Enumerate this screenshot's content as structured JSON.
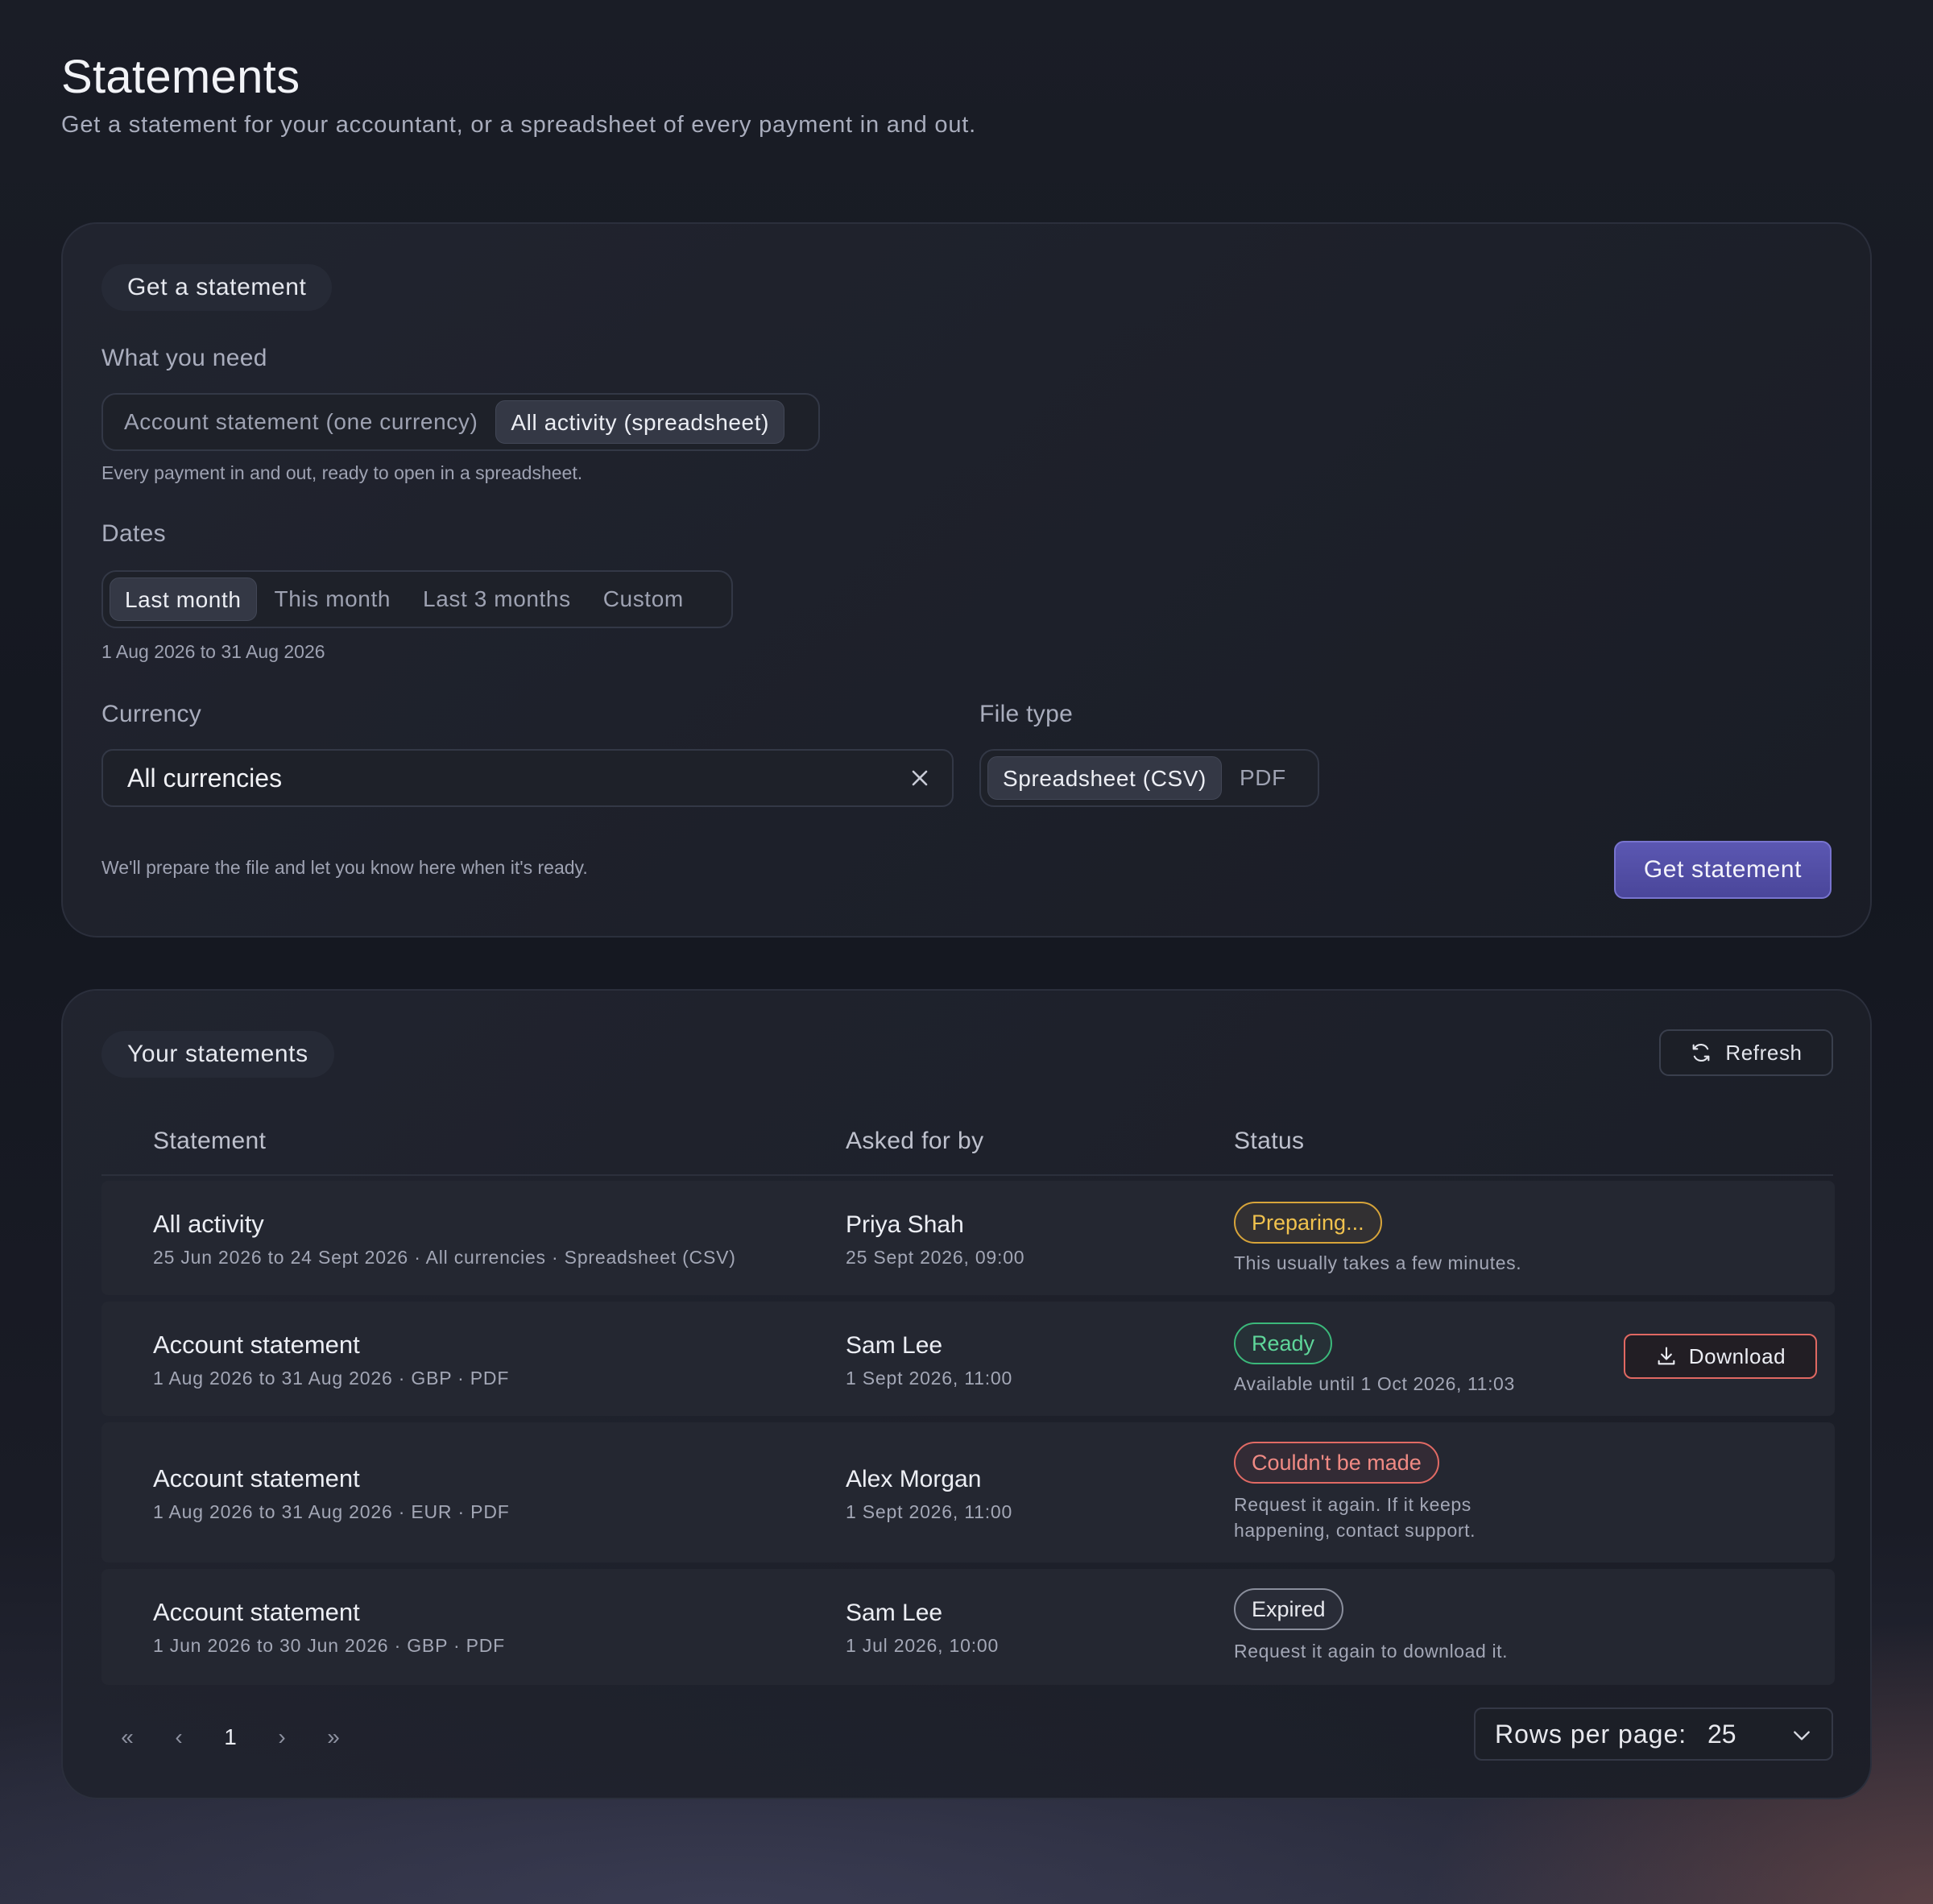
{
  "header": {
    "title": "Statements",
    "subtitle": "Get a statement for your accountant, or a spreadsheet of every payment in and out."
  },
  "form": {
    "section_title": "Get a statement",
    "need_label": "What you need",
    "need_options": [
      "Account statement (one currency)",
      "All activity (spreadsheet)"
    ],
    "need_selected": "All activity (spreadsheet)",
    "need_hint": "Every payment in and out, ready to open in a spreadsheet.",
    "dates_label": "Dates",
    "date_options": [
      "Last month",
      "This month",
      "Last 3 months",
      "Custom"
    ],
    "date_selected": "Last month",
    "date_hint": "1 Aug 2026 to 31 Aug 2026",
    "currency_label": "Currency",
    "currency_value": "All currencies",
    "file_type_label": "File type",
    "file_type_options": [
      "Spreadsheet (CSV)",
      "PDF"
    ],
    "file_type_selected": "Spreadsheet (CSV)",
    "footer_note": "We'll prepare the file and let you know here when it's ready.",
    "submit_label": "Get statement"
  },
  "list": {
    "section_title": "Your statements",
    "refresh_label": "Refresh",
    "columns": [
      "Statement",
      "Asked for by",
      "Status"
    ],
    "rows": [
      {
        "title": "All activity",
        "details": "25 Jun 2026 to 24 Sept 2026 · All currencies · Spreadsheet (CSV)",
        "requester": "Priya Shah",
        "requested_at": "25 Sept 2026, 09:00",
        "status": "Preparing...",
        "status_kind": "preparing",
        "status_note": "This usually takes a few minutes."
      },
      {
        "title": "Account statement",
        "details": "1 Aug 2026 to 31 Aug 2026 · GBP · PDF",
        "requester": "Sam Lee",
        "requested_at": "1 Sept 2026, 11:00",
        "status": "Ready",
        "status_kind": "ready",
        "status_note": "Available until 1 Oct 2026, 11:03",
        "action_label": "Download"
      },
      {
        "title": "Account statement",
        "details": "1 Aug 2026 to 31 Aug 2026 · EUR · PDF",
        "requester": "Alex Morgan",
        "requested_at": "1 Sept 2026, 11:00",
        "status": "Couldn't be made",
        "status_kind": "failed",
        "status_note": "Request it again. If it keeps happening, contact support."
      },
      {
        "title": "Account statement",
        "details": "1 Jun 2026 to 30 Jun 2026 · GBP · PDF",
        "requester": "Sam Lee",
        "requested_at": "1 Jul 2026, 10:00",
        "status": "Expired",
        "status_kind": "expired",
        "status_note": "Request it again to download it."
      }
    ],
    "pagination": {
      "first": "«",
      "prev": "‹",
      "current_page": "1",
      "next": "›",
      "last": "»",
      "rows_per_page_label": "Rows per page:",
      "rows_per_page_value": "25"
    }
  },
  "colors": {
    "accent": "#5b57b2",
    "preparing": "#f1c24e",
    "ready": "#5fd69a",
    "failed": "#f08a84",
    "expired": "#e8e9ee"
  }
}
